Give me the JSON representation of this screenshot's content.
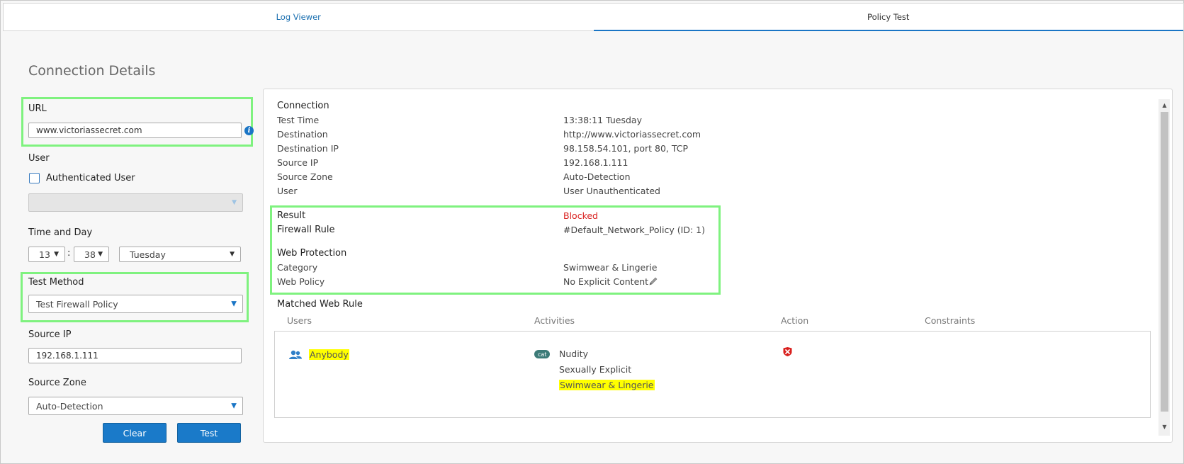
{
  "tabs": [
    {
      "label": "Log Viewer"
    },
    {
      "label": "Policy Test"
    }
  ],
  "page_title": "Connection Details",
  "form": {
    "url_label": "URL",
    "url_value": "www.victoriassecret.com",
    "user_label": "User",
    "authenticated_user_label": "Authenticated User",
    "time_day_label": "Time and Day",
    "hour": "13",
    "time_separator": ":",
    "minute": "38",
    "day": "Tuesday",
    "test_method_label": "Test Method",
    "test_method_value": "Test Firewall Policy",
    "source_ip_label": "Source IP",
    "source_ip_value": "192.168.1.111",
    "source_zone_label": "Source Zone",
    "source_zone_value": "Auto-Detection",
    "clear_label": "Clear",
    "test_label": "Test"
  },
  "details": {
    "connection_heading": "Connection",
    "rows": [
      {
        "label": "Test Time",
        "value": "13:38:11 Tuesday"
      },
      {
        "label": "Destination",
        "value": "http://www.victoriassecret.com"
      },
      {
        "label": "Destination IP",
        "value": "98.158.54.101, port 80, TCP"
      },
      {
        "label": "Source IP",
        "value": "192.168.1.111"
      },
      {
        "label": "Source Zone",
        "value": "Auto-Detection"
      },
      {
        "label": "User",
        "value": "User Unauthenticated"
      }
    ],
    "result_label": "Result",
    "result_value": "Blocked",
    "firewall_rule_label": "Firewall Rule",
    "firewall_rule_value": "#Default_Network_Policy (ID: 1)",
    "web_protection_heading": "Web Protection",
    "category_label": "Category",
    "category_value": "Swimwear & Lingerie",
    "web_policy_label": "Web Policy",
    "web_policy_value": "No Explicit Content",
    "matched_rule_heading": "Matched Web Rule",
    "columns": [
      "Users",
      "Activities",
      "Action",
      "Constraints"
    ],
    "rule_user": "Anybody",
    "cat_badge": "cat",
    "activities": [
      "Nudity",
      "Sexually Explicit",
      "Swimwear & Lingerie"
    ]
  },
  "colors": {
    "accent": "#1a75c5",
    "highlight_box": "#7ff27f",
    "blocked": "#d9201e",
    "match_highlight": "#ffff00"
  },
  "icons": {
    "info": "info-icon",
    "users": "users-icon",
    "block": "block-icon",
    "edit": "pencil-icon"
  }
}
